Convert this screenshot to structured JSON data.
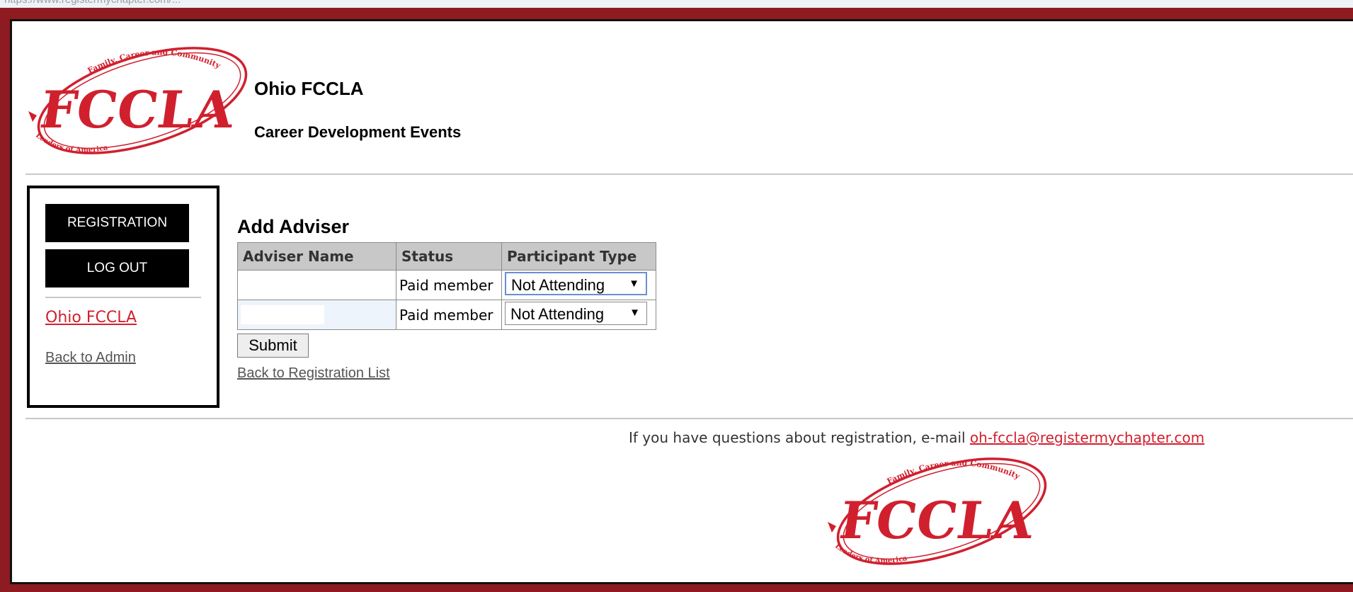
{
  "browser": {
    "url": "https://www.registermychapter.com/..."
  },
  "header": {
    "title": "Ohio FCCLA",
    "subtitle": "Career Development Events",
    "logo": {
      "text": "FCCLA",
      "arc_top": "Family, Career and Community",
      "arc_bottom": "Leaders of America"
    }
  },
  "sidebar": {
    "registration_label": "REGISTRATION",
    "logout_label": "LOG OUT",
    "org_link": "Ohio FCCLA",
    "admin_link": "Back to Admin"
  },
  "main": {
    "heading": "Add Adviser",
    "columns": [
      "Adviser Name",
      "Status",
      "Participant Type"
    ],
    "rows": [
      {
        "name": "",
        "status": "Paid member",
        "participant_type": "Not Attending"
      },
      {
        "name": "",
        "status": "Paid member",
        "participant_type": "Not Attending"
      }
    ],
    "submit_label": "Submit",
    "back_link": "Back to Registration List"
  },
  "footer": {
    "note": "If you have questions about registration, e-mail ",
    "email": "oh-fccla@registermychapter.com"
  },
  "colors": {
    "frame": "#8e1a22",
    "brand_red": "#d0202e",
    "nav_bg": "#000000",
    "table_header": "#c8c8c8"
  }
}
